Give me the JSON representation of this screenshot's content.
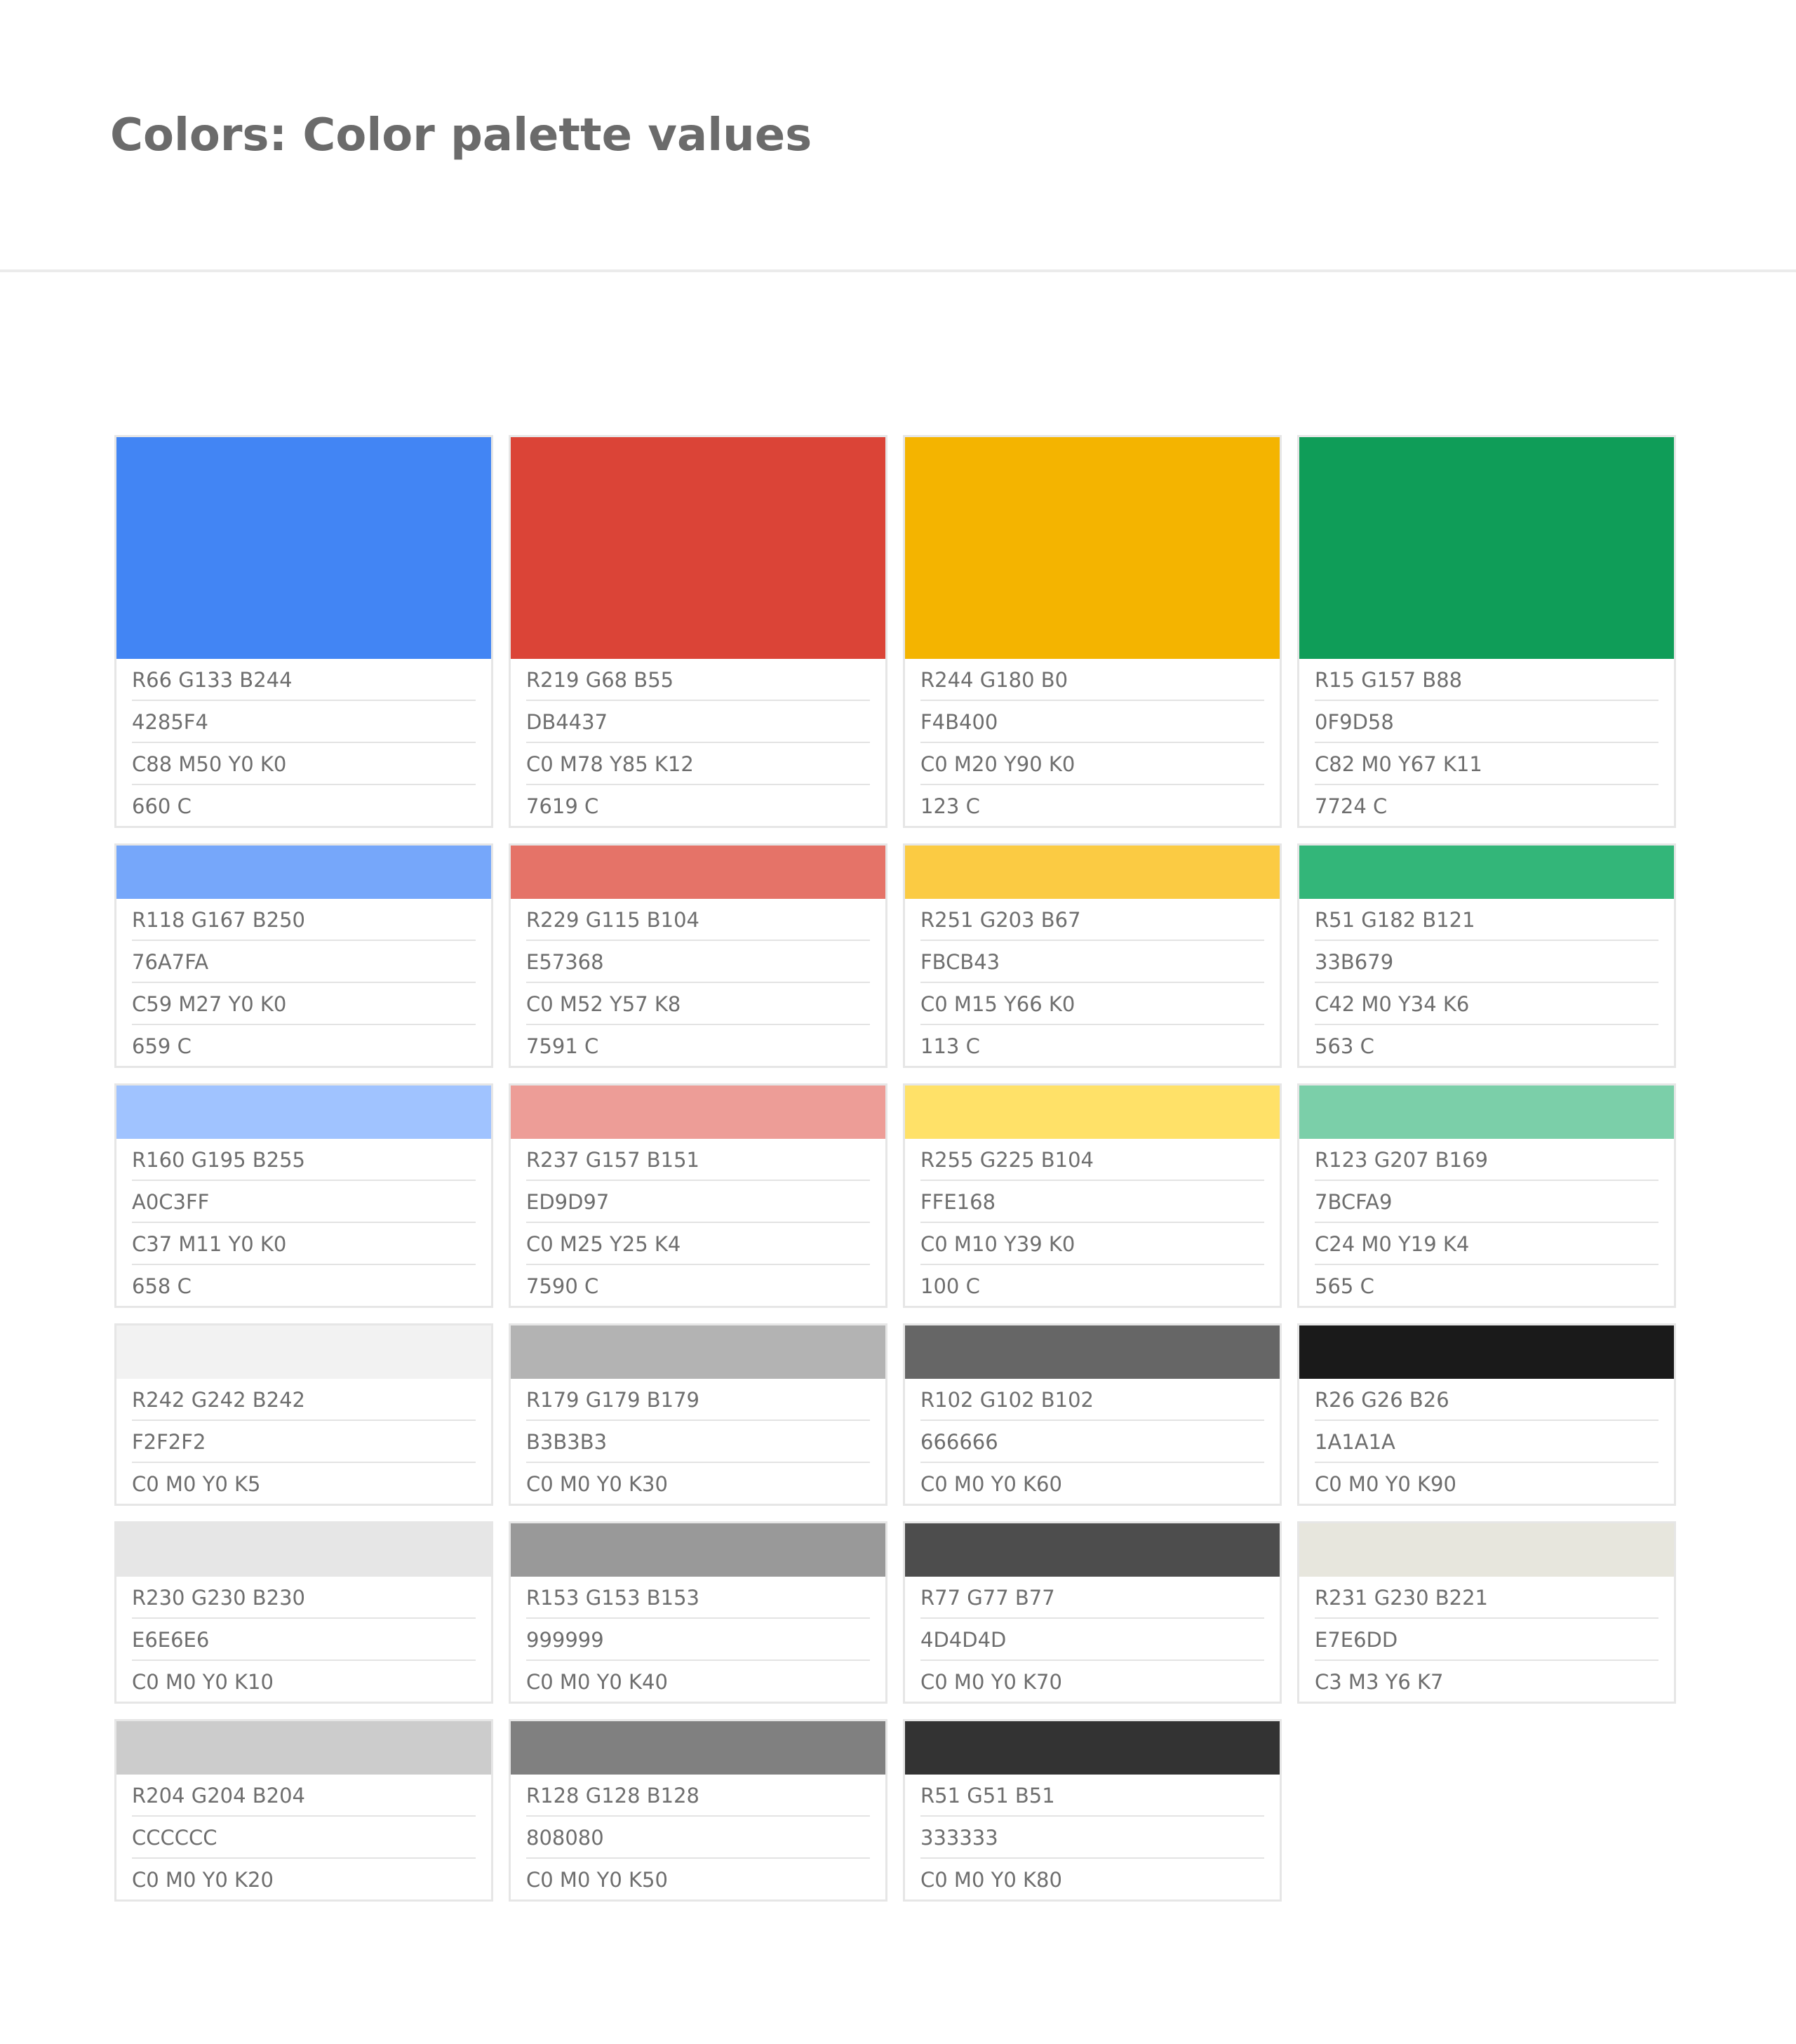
{
  "page": {
    "title": "Colors: Color palette values"
  },
  "palette": {
    "rows": [
      {
        "size": "big",
        "cards": [
          {
            "color": "#4285F4",
            "values": [
              "R66 G133 B244",
              "4285F4",
              "C88 M50 Y0 K0",
              "660 C"
            ]
          },
          {
            "color": "#DB4437",
            "values": [
              "R219 G68 B55",
              "DB4437",
              "C0 M78 Y85 K12",
              "7619 C"
            ]
          },
          {
            "color": "#F4B400",
            "values": [
              "R244 G180 B0",
              "F4B400",
              "C0 M20 Y90 K0",
              "123 C"
            ]
          },
          {
            "color": "#0F9D58",
            "values": [
              "R15 G157 B88",
              "0F9D58",
              "C82 M0 Y67 K11",
              "7724 C"
            ]
          }
        ]
      },
      {
        "size": "small",
        "cards": [
          {
            "color": "#76A7FA",
            "values": [
              "R118 G167 B250",
              "76A7FA",
              "C59 M27 Y0 K0",
              "659 C"
            ]
          },
          {
            "color": "#E57368",
            "values": [
              "R229 G115 B104",
              "E57368",
              "C0 M52 Y57 K8",
              "7591 C"
            ]
          },
          {
            "color": "#FBCB43",
            "values": [
              "R251 G203 B67",
              "FBCB43",
              "C0 M15 Y66 K0",
              "113 C"
            ]
          },
          {
            "color": "#33B679",
            "values": [
              "R51 G182  B121",
              "33B679",
              "C42 M0 Y34 K6",
              "563 C"
            ]
          }
        ]
      },
      {
        "size": "small",
        "cards": [
          {
            "color": "#A0C3FF",
            "values": [
              "R160 G195 B255",
              "A0C3FF",
              "C37 M11 Y0 K0",
              "658 C"
            ]
          },
          {
            "color": "#ED9D97",
            "values": [
              "R237 G157 B151",
              "ED9D97",
              "C0 M25 Y25 K4",
              "7590 C"
            ]
          },
          {
            "color": "#FFE168",
            "values": [
              "R255 G225 B104",
              "FFE168",
              "C0 M10 Y39 K0",
              "100 C"
            ]
          },
          {
            "color": "#7BCFA9",
            "values": [
              "R123 G207 B169",
              "7BCFA9",
              "C24 M0 Y19 K4",
              "565 C"
            ]
          }
        ]
      },
      {
        "size": "small",
        "cards": [
          {
            "color": "#F2F2F2",
            "values": [
              "R242 G242 B242",
              "F2F2F2",
              "C0 M0 Y0 K5"
            ]
          },
          {
            "color": "#B3B3B3",
            "values": [
              "R179 G179 B179",
              "B3B3B3",
              "C0 M0 Y0 K30"
            ]
          },
          {
            "color": "#666666",
            "values": [
              "R102 G102 B102",
              "666666",
              "C0 M0 Y0 K60"
            ]
          },
          {
            "color": "#1A1A1A",
            "values": [
              "R26 G26 B26",
              "1A1A1A",
              "C0 M0 Y0 K90"
            ]
          }
        ]
      },
      {
        "size": "small",
        "cards": [
          {
            "color": "#E6E6E6",
            "values": [
              "R230 G230 B230",
              "E6E6E6",
              "C0 M0 Y0 K10"
            ]
          },
          {
            "color": "#999999",
            "values": [
              "R153 G153 B153",
              "999999",
              "C0 M0 Y0 K40"
            ]
          },
          {
            "color": "#4D4D4D",
            "values": [
              "R77 G77 B77",
              "4D4D4D",
              "C0 M0 Y0 K70"
            ]
          },
          {
            "color": "#E7E6DD",
            "values": [
              "R231 G230 B221",
              "E7E6DD",
              "C3 M3 Y6 K7"
            ]
          }
        ]
      },
      {
        "size": "small",
        "cards": [
          {
            "color": "#CCCCCC",
            "values": [
              "R204 G204 B204",
              "CCCCCC",
              "C0 M0 Y0 K20"
            ]
          },
          {
            "color": "#808080",
            "values": [
              "R128 G128 B128",
              "808080",
              "C0 M0 Y0 K50"
            ]
          },
          {
            "color": "#333333",
            "values": [
              "R51 G51 B51",
              "333333",
              "C0 M0 Y0 K80"
            ]
          }
        ]
      }
    ]
  }
}
